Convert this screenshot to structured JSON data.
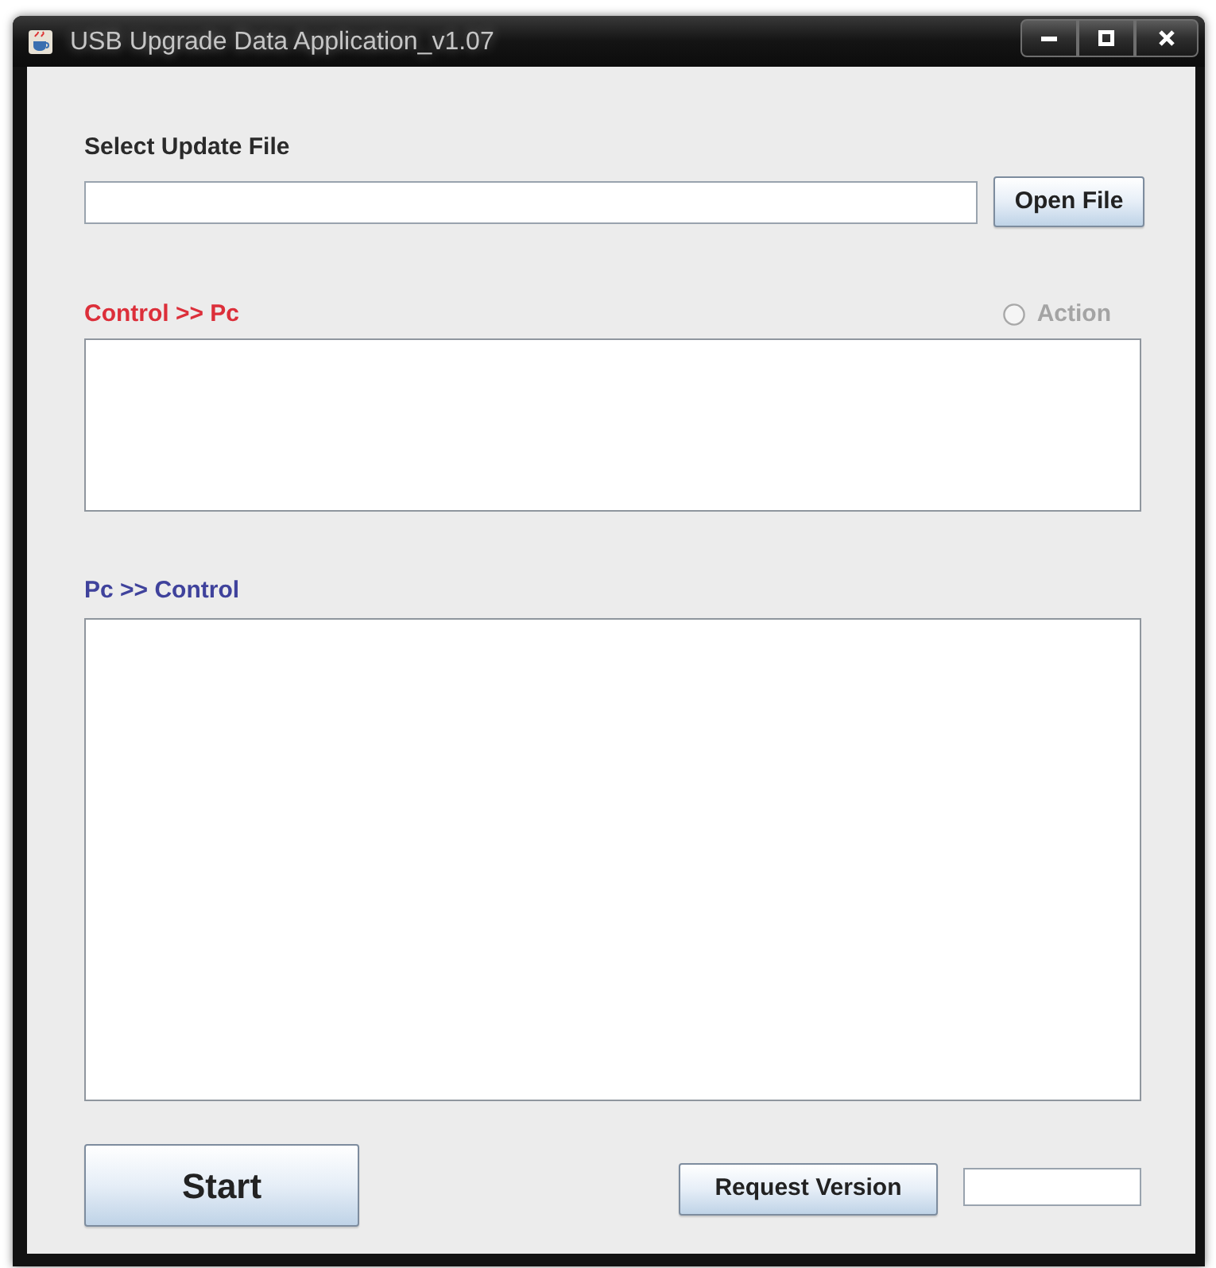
{
  "window": {
    "title": "USB Upgrade Data Application_v1.07"
  },
  "file_select": {
    "label": "Select Update File",
    "button": "Open File"
  },
  "panels": [
    {
      "label": "Control >> Pc",
      "color": "#dc2f3a",
      "option": {
        "label": "Action",
        "checked": false,
        "disabled": true
      }
    },
    {
      "label": "Pc >> Control",
      "color": "#3f429c"
    }
  ],
  "footer": {
    "start_button": "Start",
    "request_button": "Request Version"
  }
}
